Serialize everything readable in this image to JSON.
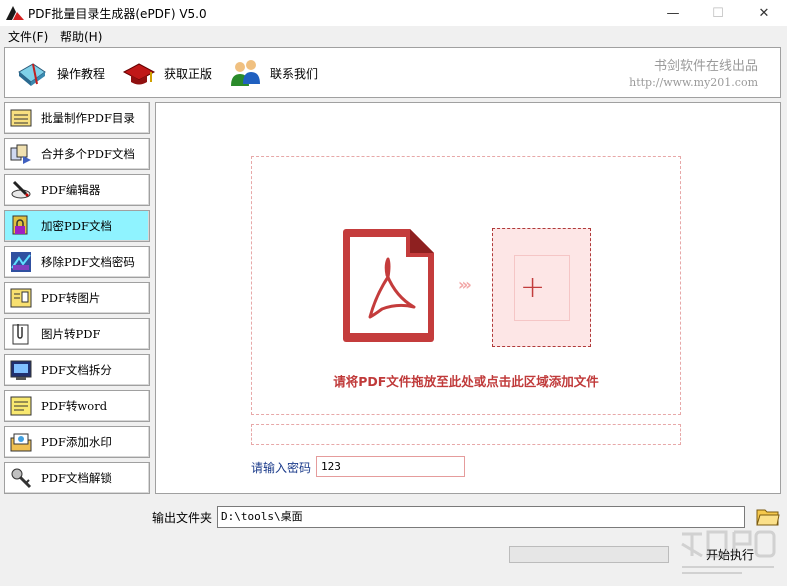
{
  "window": {
    "title": "PDF批量目录生成器(ePDF) V5.0",
    "min_glyph": "—",
    "max_glyph": "☐",
    "close_glyph": "✕"
  },
  "menu": [
    {
      "label": "文件(F)"
    },
    {
      "label": "帮助(H)"
    }
  ],
  "toolbar": {
    "items": [
      {
        "label": "操作教程",
        "icon": "tutorial-book-icon"
      },
      {
        "label": "获取正版",
        "icon": "red-cap-icon"
      },
      {
        "label": "联系我们",
        "icon": "people-icon"
      }
    ],
    "brand_line1": "书剑软件在线出品",
    "brand_line2": "http://www.my201.com"
  },
  "sidebar": {
    "items": [
      {
        "label": "批量制作PDF目录",
        "icon": "list-icon",
        "active": false
      },
      {
        "label": "合并多个PDF文档",
        "icon": "merge-icon",
        "active": false
      },
      {
        "label": "PDF编辑器",
        "icon": "pen-icon",
        "active": false
      },
      {
        "label": "加密PDF文档",
        "icon": "lock-file-icon",
        "active": true
      },
      {
        "label": "移除PDF文档密码",
        "icon": "remove-password-icon",
        "active": false
      },
      {
        "label": "PDF转图片",
        "icon": "image-icon",
        "active": false
      },
      {
        "label": "图片转PDF",
        "icon": "clip-icon",
        "active": false
      },
      {
        "label": "PDF文档拆分",
        "icon": "split-icon",
        "active": false
      },
      {
        "label": "PDF转word",
        "icon": "note-icon",
        "active": false
      },
      {
        "label": "PDF添加水印",
        "icon": "watermark-icon",
        "active": false
      },
      {
        "label": "PDF文档解锁",
        "icon": "unlock-icon",
        "active": false
      }
    ]
  },
  "main": {
    "arrows": "›››",
    "plus": "+",
    "drop_text": "请将PDF文件拖放至此处或点击此区域添加文件",
    "password_label": "请输入密码",
    "password_value": "123"
  },
  "footer": {
    "output_label": "输出文件夹",
    "output_value": "D:\\tools\\桌面",
    "progress": 0,
    "start_label": "开始执行"
  },
  "colors": {
    "accent_red": "#c03a3a",
    "active_item": "#8ff3ff"
  }
}
